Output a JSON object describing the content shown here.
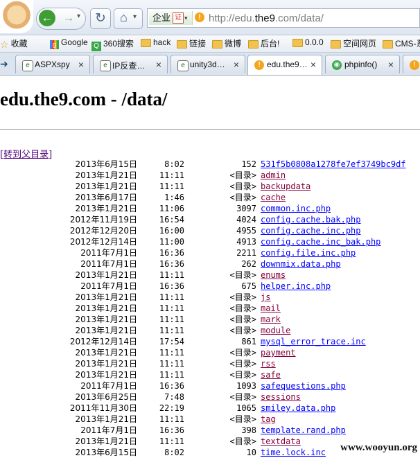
{
  "browser": {
    "back_icon": "arrow-left-icon",
    "forward_icon": "arrow-right-icon",
    "refresh_icon": "refresh-icon",
    "home_icon": "home-icon",
    "cert_label": "企业",
    "cert_badge": "证",
    "url_prefix": "http://edu.",
    "url_domain": "the9",
    "url_suffix": ".com/data/"
  },
  "bookmarks": [
    {
      "label": "收藏",
      "icon": "star-icon"
    },
    {
      "label": "Google",
      "icon": "google-icon"
    },
    {
      "label": "360搜索",
      "icon": "search-360-icon"
    },
    {
      "label": "hack",
      "icon": "folder-icon"
    },
    {
      "label": "链接",
      "icon": "folder-icon"
    },
    {
      "label": "微博",
      "icon": "folder-icon"
    },
    {
      "label": "后台!",
      "icon": "folder-icon"
    },
    {
      "label": "0.0.0",
      "icon": "folder-icon"
    },
    {
      "label": "空间网页",
      "icon": "folder-icon"
    },
    {
      "label": "CMS-系",
      "icon": "folder-icon"
    }
  ],
  "tabs": [
    {
      "title": "ASPXspy",
      "icon": "ie-page-icon"
    },
    {
      "title": "IP反查…",
      "icon": "ie-page-icon"
    },
    {
      "title": "unity3d…",
      "icon": "ie-page-icon"
    },
    {
      "title": "edu.the9…",
      "icon": "the9-site-icon"
    },
    {
      "title": "phpinfo()",
      "icon": "owl-icon"
    }
  ],
  "page": {
    "title": "edu.the9.com - /data/",
    "parent_link": "[转到父目录]"
  },
  "files": [
    {
      "date": "2013年6月15日",
      "time": "8:02",
      "size": "152",
      "name": "531f5b0808a1278fe7ef3749bc9df",
      "type": "file"
    },
    {
      "date": "2013年1月21日",
      "time": "11:11",
      "size": "<目录>",
      "name": "admin",
      "type": "dir"
    },
    {
      "date": "2013年1月21日",
      "time": "11:11",
      "size": "<目录>",
      "name": "backupdata",
      "type": "dir"
    },
    {
      "date": "2013年6月17日",
      "time": "1:46",
      "size": "<目录>",
      "name": "cache",
      "type": "dir"
    },
    {
      "date": "2013年1月21日",
      "time": "11:06",
      "size": "3097",
      "name": "common.inc.php",
      "type": "file"
    },
    {
      "date": "2012年11月19日",
      "time": "16:54",
      "size": "4024",
      "name": "config.cache.bak.php",
      "type": "file"
    },
    {
      "date": "2012年12月20日",
      "time": "16:00",
      "size": "4955",
      "name": "config.cache.inc.php",
      "type": "file"
    },
    {
      "date": "2012年12月14日",
      "time": "11:00",
      "size": "4913",
      "name": "config.cache.inc_bak.php",
      "type": "file"
    },
    {
      "date": "2011年7月1日",
      "time": "16:36",
      "size": "2211",
      "name": "config.file.inc.php",
      "type": "file"
    },
    {
      "date": "2011年7月1日",
      "time": "16:36",
      "size": "262",
      "name": "downmix.data.php",
      "type": "file"
    },
    {
      "date": "2013年1月21日",
      "time": "11:11",
      "size": "<目录>",
      "name": "enums",
      "type": "dir"
    },
    {
      "date": "2011年7月1日",
      "time": "16:36",
      "size": "675",
      "name": "helper.inc.php",
      "type": "file"
    },
    {
      "date": "2013年1月21日",
      "time": "11:11",
      "size": "<目录>",
      "name": "js",
      "type": "dir"
    },
    {
      "date": "2013年1月21日",
      "time": "11:11",
      "size": "<目录>",
      "name": "mail",
      "type": "dir"
    },
    {
      "date": "2013年1月21日",
      "time": "11:11",
      "size": "<目录>",
      "name": "mark",
      "type": "dir"
    },
    {
      "date": "2013年1月21日",
      "time": "11:11",
      "size": "<目录>",
      "name": "module",
      "type": "dir"
    },
    {
      "date": "2012年12月14日",
      "time": "17:54",
      "size": "861",
      "name": "mysql_error_trace.inc",
      "type": "file"
    },
    {
      "date": "2013年1月21日",
      "time": "11:11",
      "size": "<目录>",
      "name": "payment",
      "type": "dir"
    },
    {
      "date": "2013年1月21日",
      "time": "11:11",
      "size": "<目录>",
      "name": "rss",
      "type": "dir"
    },
    {
      "date": "2013年1月21日",
      "time": "11:11",
      "size": "<目录>",
      "name": "safe",
      "type": "dir"
    },
    {
      "date": "2011年7月1日",
      "time": "16:36",
      "size": "1093",
      "name": "safequestions.php",
      "type": "file"
    },
    {
      "date": "2013年6月25日",
      "time": "7:48",
      "size": "<目录>",
      "name": "sessions",
      "type": "dir"
    },
    {
      "date": "2011年11月30日",
      "time": "22:19",
      "size": "1065",
      "name": "smiley.data.php",
      "type": "file"
    },
    {
      "date": "2013年1月21日",
      "time": "11:11",
      "size": "<目录>",
      "name": "tag",
      "type": "dir"
    },
    {
      "date": "2011年7月1日",
      "time": "16:36",
      "size": "398",
      "name": "template.rand.php",
      "type": "file"
    },
    {
      "date": "2013年1月21日",
      "time": "11:11",
      "size": "<目录>",
      "name": "textdata",
      "type": "dir"
    },
    {
      "date": "2013年6月15日",
      "time": "8:02",
      "size": "10",
      "name": "time.lock.inc",
      "type": "file"
    }
  ],
  "watermark": "www.wooyun.org"
}
